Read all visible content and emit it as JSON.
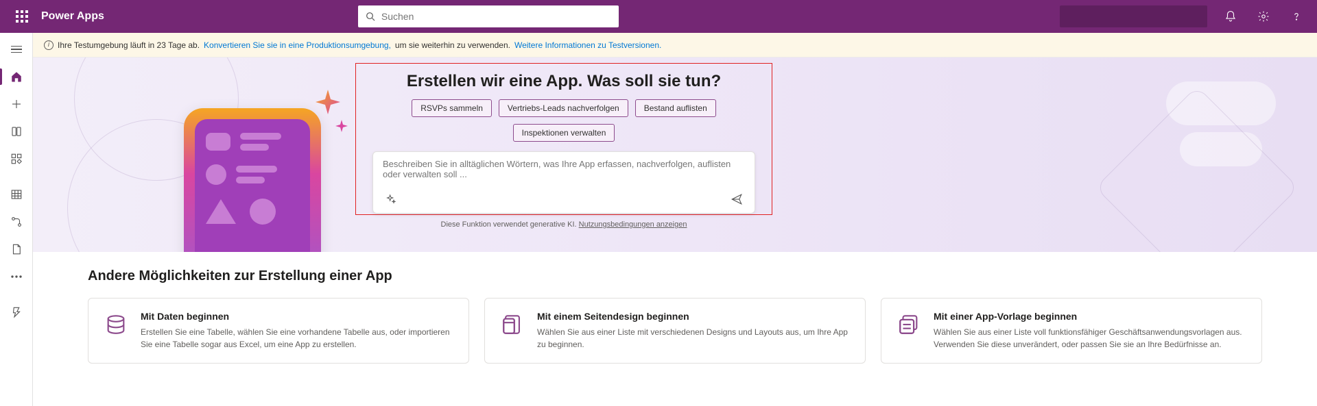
{
  "header": {
    "brand": "Power Apps",
    "search_placeholder": "Suchen"
  },
  "banner": {
    "text_prefix": "Ihre Testumgebung läuft in 23 Tage ab.",
    "link1": "Konvertieren Sie sie in eine Produktionsumgebung,",
    "text_middle": "um sie weiterhin zu verwenden.",
    "link2": "Weitere Informationen zu Testversionen."
  },
  "prompt": {
    "title": "Erstellen wir eine App. Was soll sie tun?",
    "chips": {
      "c0": "RSVPs sammeln",
      "c1": "Vertriebs-Leads nachverfolgen",
      "c2": "Bestand auflisten",
      "c3": "Inspektionen verwalten"
    },
    "placeholder": "Beschreiben Sie in alltäglichen Wörtern, was Ihre App erfassen, nachverfolgen, auflisten oder verwalten soll ...",
    "ai_note_text": "Diese Funktion verwendet generative KI.",
    "ai_note_link": "Nutzungsbedingungen anzeigen"
  },
  "lower": {
    "heading": "Andere Möglichkeiten zur Erstellung einer App",
    "cards": {
      "data": {
        "title": "Mit Daten beginnen",
        "desc": "Erstellen Sie eine Tabelle, wählen Sie eine vorhandene Tabelle aus, oder importieren Sie eine Tabelle sogar aus Excel, um eine App zu erstellen."
      },
      "design": {
        "title": "Mit einem Seitendesign beginnen",
        "desc": "Wählen Sie aus einer Liste mit verschiedenen Designs und Layouts aus, um Ihre App zu beginnen."
      },
      "template": {
        "title": "Mit einer App-Vorlage beginnen",
        "desc": "Wählen Sie aus einer Liste voll funktionsfähiger Geschäftsanwendungsvorlagen aus. Verwenden Sie diese unverändert, oder passen Sie sie an Ihre Bedürfnisse an."
      }
    }
  }
}
